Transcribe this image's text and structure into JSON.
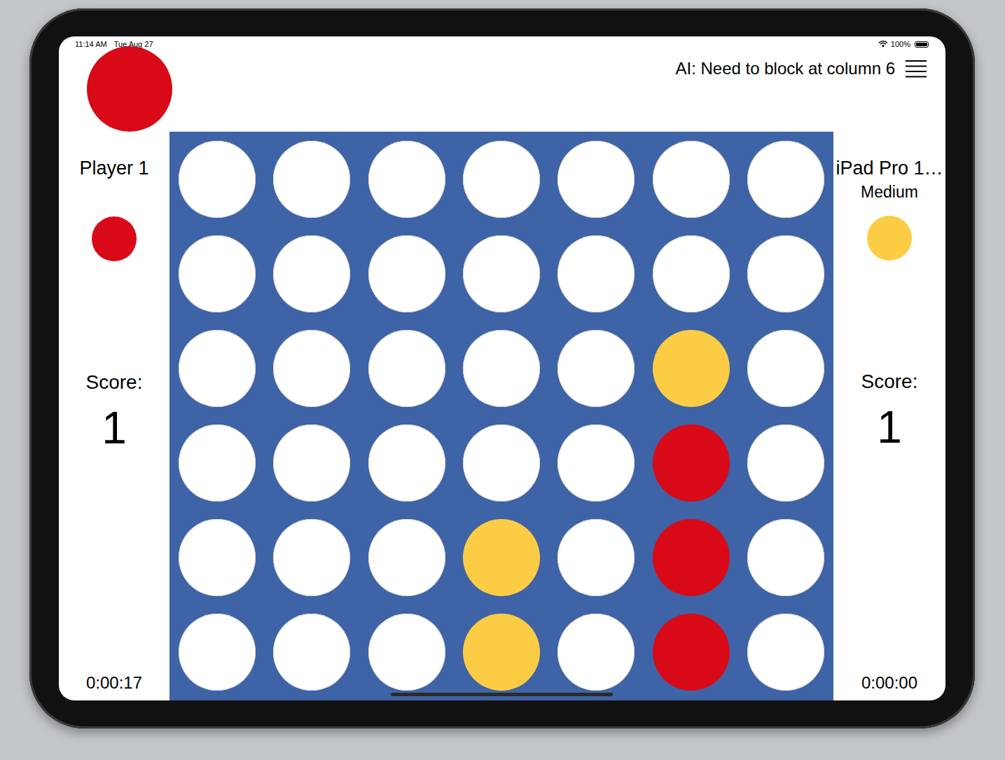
{
  "status_bar": {
    "time": "11:14 AM",
    "date": "Tue Aug 27",
    "battery": "100%",
    "battery_level": 1.0
  },
  "piece_colors": {
    "red": "#d90a17",
    "yellow": "#fccc44"
  },
  "current_turn": "red",
  "ai_message": "AI: Need to block at column 6",
  "players": [
    {
      "name": "Player 1",
      "piece": "red",
      "score_label": "Score:",
      "score": "1",
      "timer": "0:00:17"
    },
    {
      "name": "iPad Pro 1…",
      "difficulty": "Medium",
      "piece": "yellow",
      "score_label": "Score:",
      "score": "1",
      "timer": "0:00:00"
    }
  ],
  "board": {
    "rows": [
      [
        "empty",
        "empty",
        "empty",
        "empty",
        "empty",
        "empty",
        "empty"
      ],
      [
        "empty",
        "empty",
        "empty",
        "empty",
        "empty",
        "empty",
        "empty"
      ],
      [
        "empty",
        "empty",
        "empty",
        "empty",
        "empty",
        "yellow",
        "empty"
      ],
      [
        "empty",
        "empty",
        "empty",
        "empty",
        "empty",
        "red",
        "empty"
      ],
      [
        "empty",
        "empty",
        "empty",
        "yellow",
        "empty",
        "red",
        "empty"
      ],
      [
        "empty",
        "empty",
        "empty",
        "yellow",
        "empty",
        "red",
        "empty"
      ]
    ]
  }
}
